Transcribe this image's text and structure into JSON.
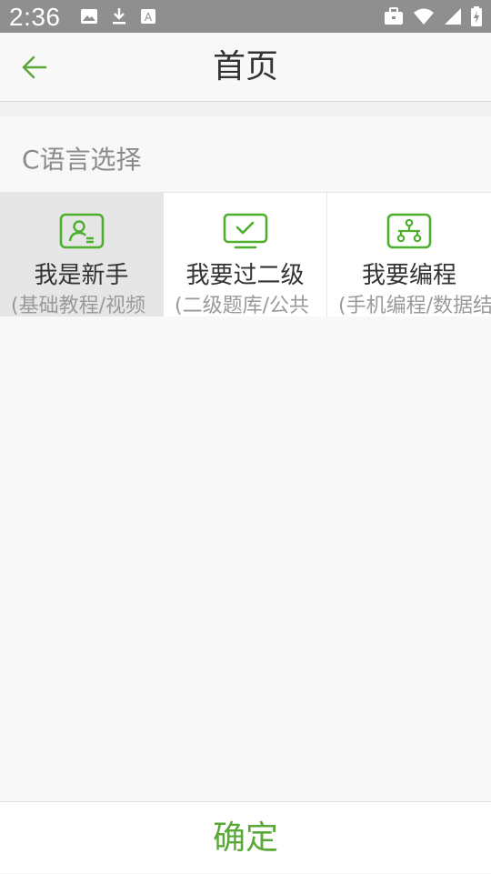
{
  "status_bar": {
    "time": "2:36",
    "left_icons": [
      "image-icon",
      "download-icon",
      "keyboard-a-icon"
    ],
    "right_icons": [
      "briefcase-icon",
      "wifi-icon",
      "signal-icon",
      "battery-charging-icon"
    ]
  },
  "app_bar": {
    "title": "首页",
    "back_icon": "arrow-left-icon",
    "accent_color": "#5aa83a"
  },
  "section": {
    "label": "C语言选择"
  },
  "options": [
    {
      "icon": "user-card-icon",
      "title": "我是新手",
      "subtitle": "(基础教程/视频",
      "selected": true
    },
    {
      "icon": "monitor-check-icon",
      "title": "我要过二级",
      "subtitle": "(二级题库/公共",
      "selected": false
    },
    {
      "icon": "network-icon",
      "title": "我要编程",
      "subtitle": "(手机编程/数据结",
      "selected": false
    }
  ],
  "bottom": {
    "confirm_label": "确定"
  }
}
